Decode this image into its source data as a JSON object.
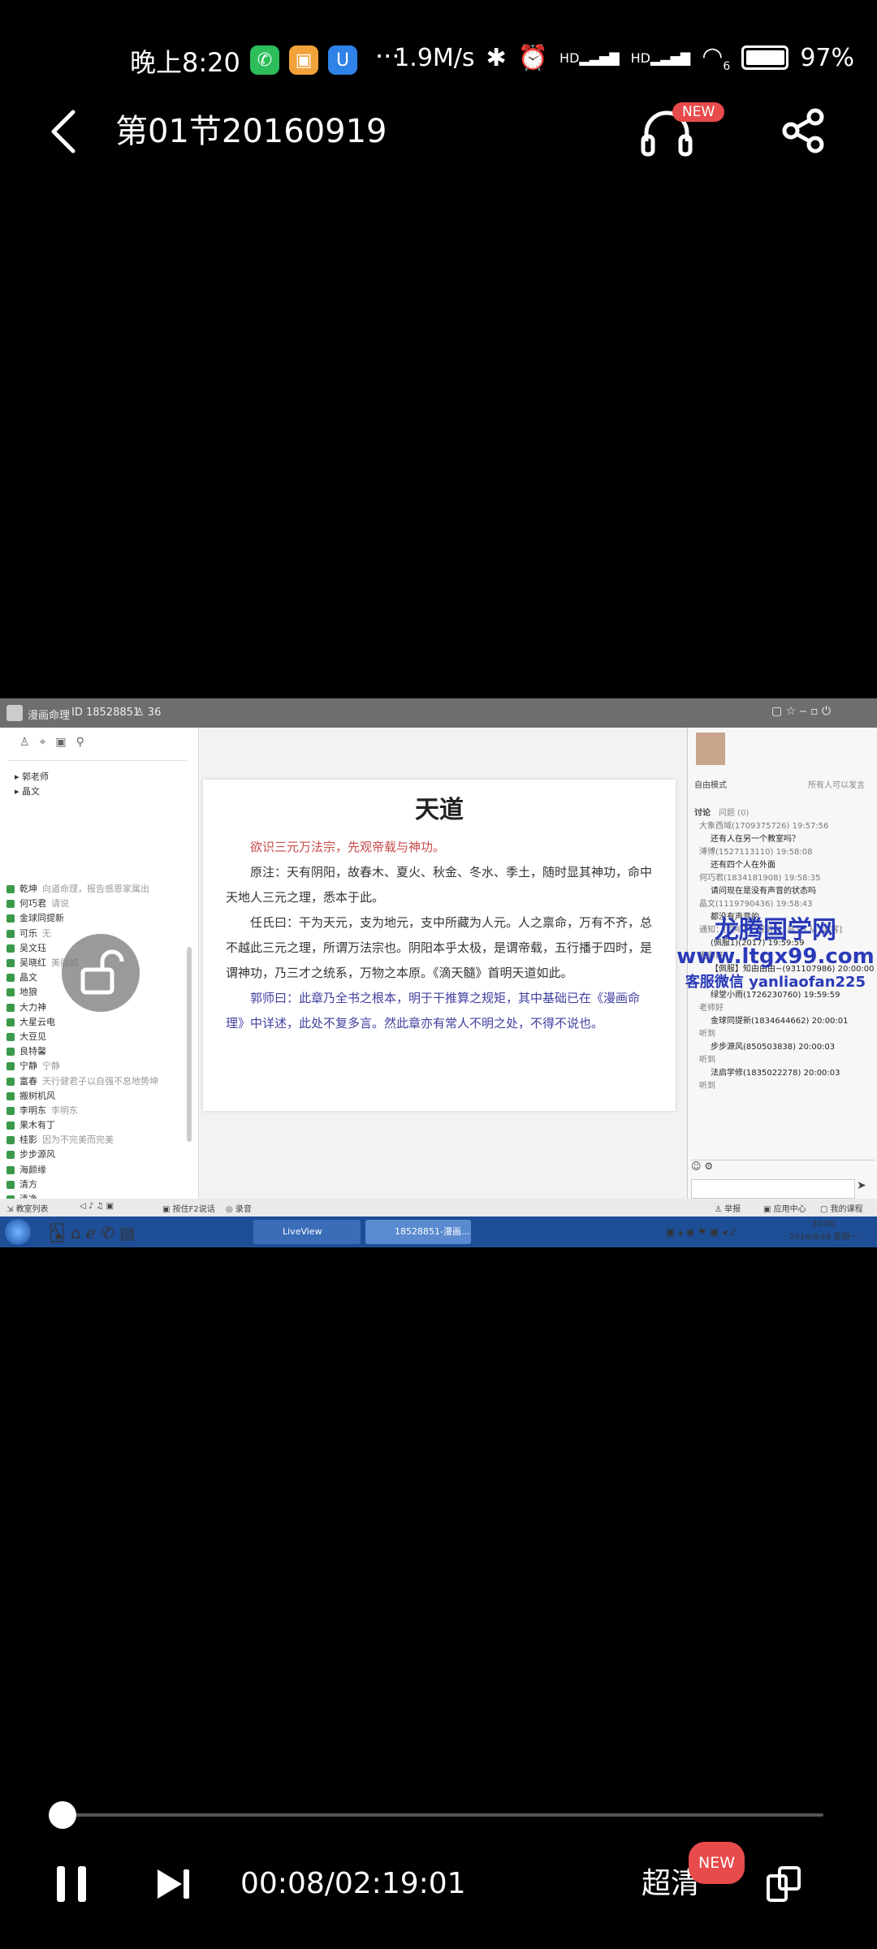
{
  "status_bar": {
    "time": "晚上8:20",
    "more": "···",
    "speed": "1.9M/s",
    "hd1": "HD",
    "hd2": "HD",
    "wifi_sub": "6",
    "battery": "97%",
    "battery_level": 0.97
  },
  "header": {
    "title": "第01节20160919",
    "audio_badge": "NEW"
  },
  "video": {
    "window_title": "漫画命理",
    "window_id": "18528851",
    "member_count": "36",
    "teachers": [
      "郭老师",
      "晶文"
    ],
    "contacts": [
      {
        "name": "乾坤",
        "note": "向道命理，报告感恩家属出"
      },
      {
        "name": "何巧君",
        "note": "请说"
      },
      {
        "name": "金球同提新",
        "note": ""
      },
      {
        "name": "可乐",
        "note": "无"
      },
      {
        "name": "吴文珏",
        "note": ""
      },
      {
        "name": "吴晓红",
        "note": "美丽如"
      },
      {
        "name": "晶文",
        "note": ""
      },
      {
        "name": "地狼",
        "note": ""
      },
      {
        "name": "大力神",
        "note": ""
      },
      {
        "name": "大星云电",
        "note": ""
      },
      {
        "name": "大豆见",
        "note": ""
      },
      {
        "name": "良特馨",
        "note": ""
      },
      {
        "name": "宁静",
        "note": "宁静"
      },
      {
        "name": "富春",
        "note": "天行健君子以自强不息地势坤"
      },
      {
        "name": "搬树机风",
        "note": ""
      },
      {
        "name": "李明东",
        "note": "李明东"
      },
      {
        "name": "果木有丁",
        "note": ""
      },
      {
        "name": "桂影",
        "note": "因为不完美而完美"
      },
      {
        "name": "步步源风",
        "note": ""
      },
      {
        "name": "海颜缘",
        "note": ""
      },
      {
        "name": "清方",
        "note": ""
      },
      {
        "name": "清净",
        "note": ""
      }
    ],
    "doc_title": "天道",
    "doc_paragraphs": [
      {
        "style": "red",
        "text": "欲识三元万法宗，先观帝载与神功。"
      },
      {
        "style": "dark",
        "text": "原注：天有阴阳，故春木、夏火、秋金、冬水、季土，随时显其神功，命中天地人三元之理，悉本于此。"
      },
      {
        "style": "dark",
        "text": "任氏曰：干为天元，支为地元，支中所藏为人元。人之禀命，万有不齐，总不越此三元之理，所谓万法宗也。阴阳本乎太极，是谓帝载，五行播于四时，是谓神功，乃三才之统系，万物之本原。《滴天髓》首明天道如此。"
      },
      {
        "style": "blue",
        "text": "郭师曰：此章乃全书之根本，明于干推算之规矩，其中基础已在《漫画命理》中详述，此处不复多言。然此章亦有常人不明之处，不得不说也。"
      }
    ],
    "right_mode": "自由模式",
    "right_hint": "所有人可以发言",
    "right_tabs": [
      "讨论",
      "问题 (0)"
    ],
    "chat": [
      "大象西域(1709375726) 19:57:56",
      "还有人在另一个教室吗？",
      "溥博(1527113110) 19:58:08",
      "还有四个人在外面",
      "何巧君(1834181908) 19:58:35",
      "请问现在是没有声音的状态吗",
      "晶文(1119790436) 19:58:43",
      "都没有声音的",
      "通知：[拉响] 已取消对 [晶文] 从 [游客]",
      "(佩服1)(2017) 19:59:59",
      "老师好",
      "【佩服】知由由由~(931107986) 20:00:00",
      "1",
      "绿堂小雨(1726230760) 19:59:59",
      "老师好",
      "金球同提新(1834644662) 20:00:01",
      "听到",
      "步步源风(850503838) 20:00:03",
      "听到",
      "法启学修(1835022278) 20:00:03",
      "听到"
    ],
    "watermark": [
      "龙腾国学网",
      "www.ltgx99.com",
      "客服微信 yanliaofan225"
    ],
    "bottom_left": [
      "教室列表",
      "按住F2说话",
      "录音"
    ],
    "bottom_right": [
      "举报",
      "应用中心",
      "我的课程"
    ],
    "taskbar_apps": [
      "LiveView",
      "18528851-漫画..."
    ],
    "taskbar_time": "20:00",
    "taskbar_date": "2016/9/19 星期一"
  },
  "player": {
    "timecode": "00:08/02:19:01",
    "quality": "超清",
    "quality_badge": "NEW",
    "progress": 0.001
  }
}
